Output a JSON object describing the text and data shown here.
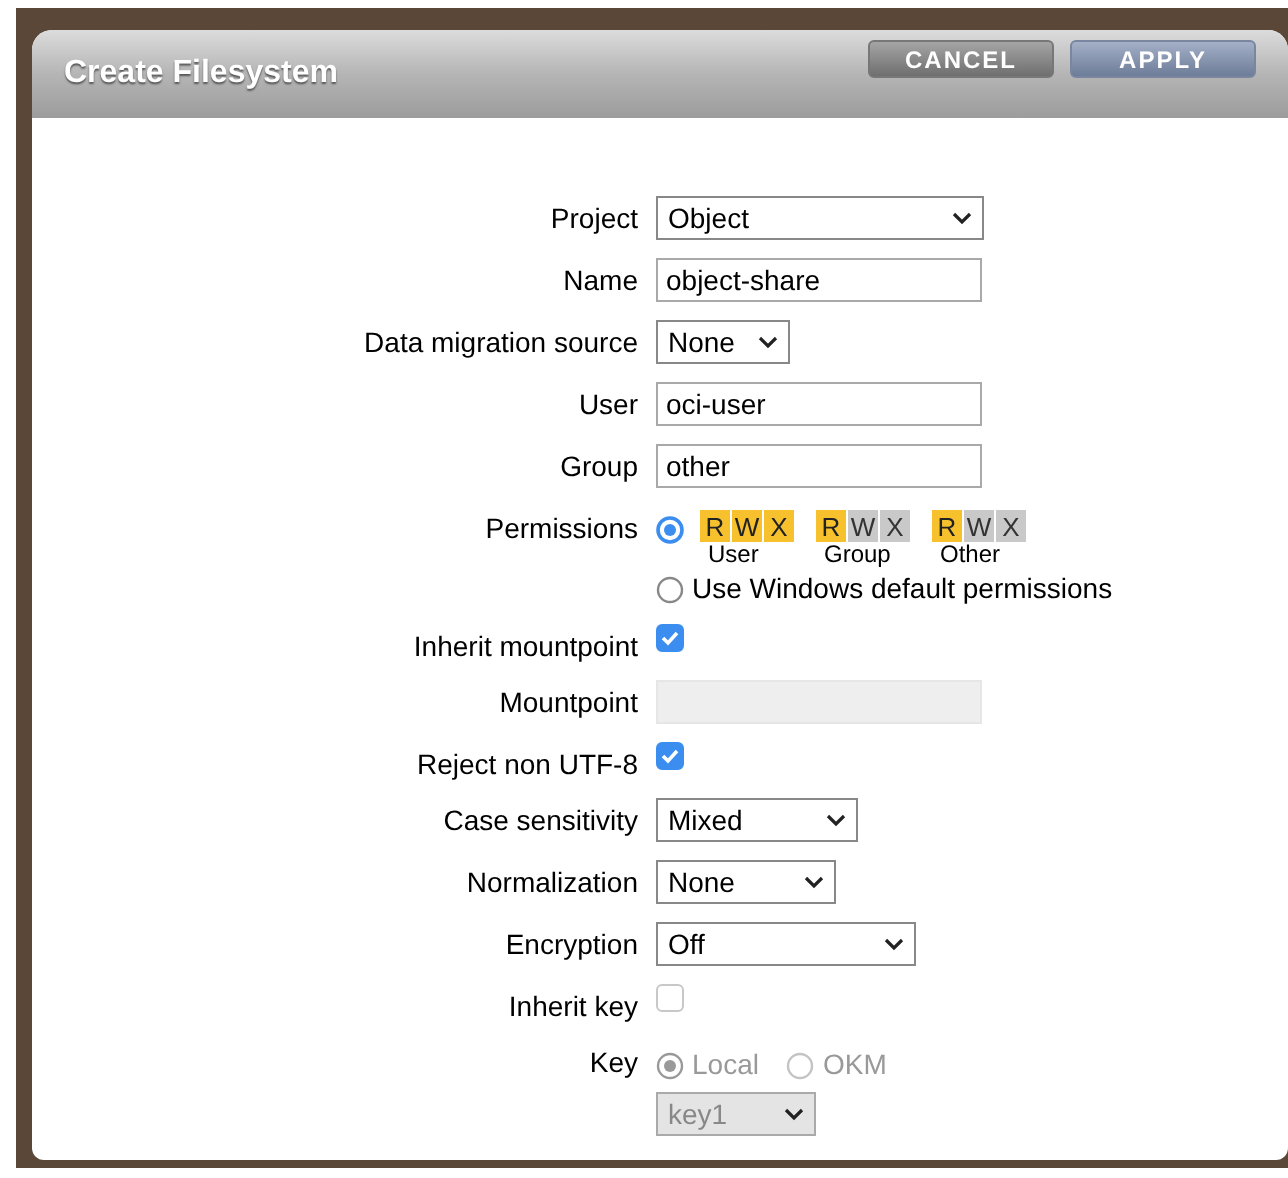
{
  "dialog": {
    "title": "Create Filesystem",
    "buttons": [
      {
        "label": "CANCEL",
        "kind": "cancel"
      },
      {
        "label": "APPLY",
        "kind": "apply"
      }
    ]
  },
  "fields": [
    {
      "kind": "select",
      "label": "Project",
      "value": "Object"
    },
    {
      "kind": "text",
      "label": "Name",
      "value": "object-share"
    },
    {
      "kind": "select",
      "label": "Data migration source",
      "value": "None"
    },
    {
      "kind": "text",
      "label": "User",
      "value": "oci-user"
    },
    {
      "kind": "text",
      "label": "Group",
      "value": "other"
    },
    {
      "kind": "permissions",
      "label": "Permissions",
      "options": [
        {
          "kind": "bits",
          "selected": true,
          "groups": [
            {
              "label": "User",
              "bits": [
                {
                  "letter": "R",
                  "on": true
                },
                {
                  "letter": "W",
                  "on": true
                },
                {
                  "letter": "X",
                  "on": true
                }
              ]
            },
            {
              "label": "Group",
              "bits": [
                {
                  "letter": "R",
                  "on": true
                },
                {
                  "letter": "W",
                  "on": false
                },
                {
                  "letter": "X",
                  "on": false
                }
              ]
            },
            {
              "label": "Other",
              "bits": [
                {
                  "letter": "R",
                  "on": true
                },
                {
                  "letter": "W",
                  "on": false
                },
                {
                  "letter": "X",
                  "on": false
                }
              ]
            }
          ]
        },
        {
          "kind": "text",
          "selected": false,
          "label": "Use Windows default permissions"
        }
      ]
    },
    {
      "kind": "checkbox",
      "label": "Inherit mountpoint",
      "checked": true
    },
    {
      "kind": "text",
      "label": "Mountpoint",
      "disabled": true
    },
    {
      "kind": "checkbox",
      "label": "Reject non UTF-8",
      "checked": true
    },
    {
      "kind": "select",
      "label": "Case sensitivity",
      "value": "Mixed"
    },
    {
      "kind": "select",
      "label": "Normalization",
      "value": "None"
    },
    {
      "kind": "select",
      "label": "Encryption",
      "value": "Off"
    },
    {
      "kind": "checkbox",
      "label": "Inherit key",
      "checked": false,
      "disabled": true
    },
    {
      "kind": "key",
      "label": "Key",
      "disabled": true,
      "options": [
        {
          "label": "Local",
          "selected": true
        },
        {
          "label": "OKM",
          "selected": false
        }
      ],
      "select": {
        "value": "key1"
      }
    }
  ]
}
